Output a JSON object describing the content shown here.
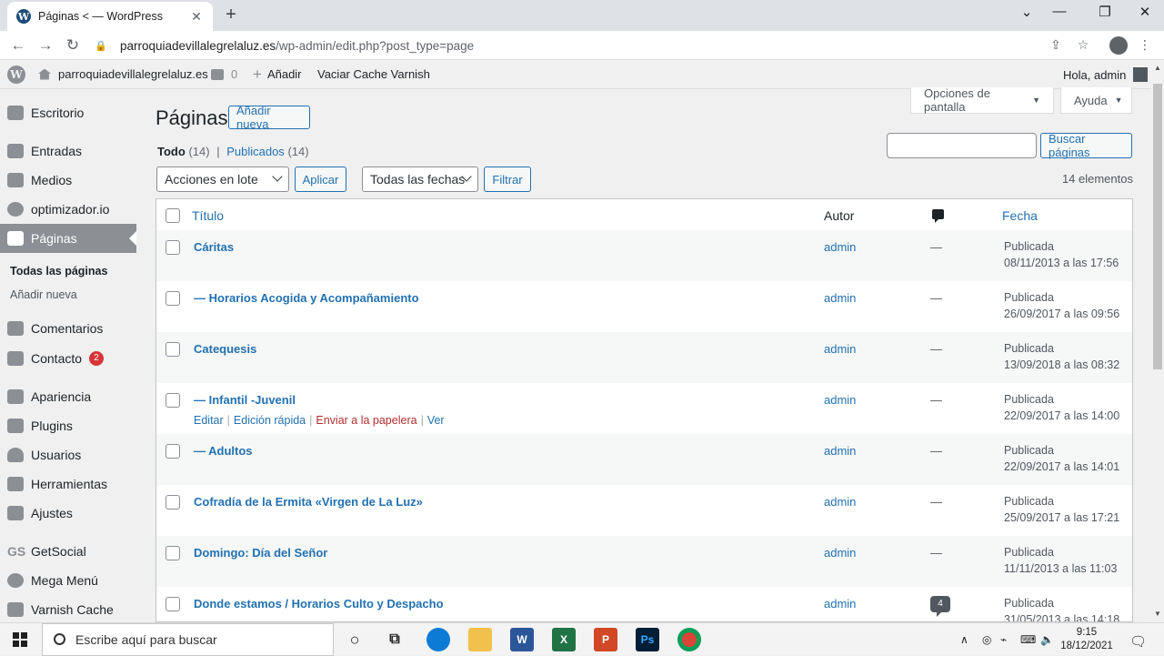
{
  "browser": {
    "tab_title": "Páginas < — WordPress",
    "tab_favicon": "W",
    "new_tab": "+",
    "url_domain": "parroquiadevillalegrelaluz.es",
    "url_path": "/wp-admin/edit.php?post_type=page"
  },
  "admin_bar": {
    "logo": "W",
    "site_name": "parroquiadevillalegrelaluz.es",
    "comments_count": "0",
    "add_new": "Añadir",
    "cache": "Vaciar Cache Varnish",
    "greeting": "Hola, admin"
  },
  "sidebar": {
    "dashboard": "Escritorio",
    "posts": "Entradas",
    "media": "Medios",
    "optimizer": "optimizador.io",
    "pages": "Páginas",
    "pages_all": "Todas las páginas",
    "pages_add": "Añadir nueva",
    "comments": "Comentarios",
    "contact": "Contacto",
    "contact_badge": "2",
    "appearance": "Apariencia",
    "plugins": "Plugins",
    "users": "Usuarios",
    "tools": "Herramientas",
    "settings": "Ajustes",
    "getsocial_icon": "GS",
    "getsocial": "GetSocial",
    "megamenu": "Mega Menú",
    "varnish": "Varnish Cache"
  },
  "main": {
    "screen_options": "Opciones de pantalla",
    "help": "Ayuda",
    "title": "Páginas",
    "add_new": "Añadir nueva",
    "filter_all": "Todo",
    "filter_all_count": "(14)",
    "filter_sep": "|",
    "filter_published": "Publicados",
    "filter_published_count": "(14)",
    "search_button": "Buscar páginas",
    "bulk_actions": "Acciones en lote",
    "apply": "Aplicar",
    "all_dates": "Todas las fechas",
    "filter": "Filtrar",
    "items_count": "14 elementos"
  },
  "table": {
    "col_title": "Título",
    "col_author": "Autor",
    "col_date": "Fecha",
    "row_actions": {
      "edit": "Editar",
      "quick_edit": "Edición rápida",
      "trash": "Enviar a la papelera",
      "view": "Ver",
      "sep": "|"
    },
    "rows": [
      {
        "title": "Cáritas",
        "author": "admin",
        "comments": "—",
        "status": "Publicada",
        "date": "08/11/2013 a las 17:56"
      },
      {
        "title": "— Horarios Acogida y Acompañamiento",
        "author": "admin",
        "comments": "—",
        "status": "Publicada",
        "date": "26/09/2017 a las 09:56"
      },
      {
        "title": "Catequesis",
        "author": "admin",
        "comments": "—",
        "status": "Publicada",
        "date": "13/09/2018 a las 08:32"
      },
      {
        "title": "— Infantil -Juvenil",
        "author": "admin",
        "comments": "—",
        "status": "Publicada",
        "date": "22/09/2017 a las 14:00"
      },
      {
        "title": "— Adultos",
        "author": "admin",
        "comments": "—",
        "status": "Publicada",
        "date": "22/09/2017 a las 14:01"
      },
      {
        "title": "Cofradía de la Ermita «Virgen de La Luz»",
        "author": "admin",
        "comments": "—",
        "status": "Publicada",
        "date": "25/09/2017 a las 17:21"
      },
      {
        "title": "Domingo: Día del Señor",
        "author": "admin",
        "comments": "—",
        "status": "Publicada",
        "date": "11/11/2013 a las 11:03"
      },
      {
        "title": "Donde estamos / Horarios Culto y Despacho",
        "author": "admin",
        "comments": "4",
        "status": "Publicada",
        "date": "31/05/2013 a las 14:18"
      }
    ]
  },
  "taskbar": {
    "search_placeholder": "Escribe aquí para buscar",
    "word": "W",
    "excel": "X",
    "powerpoint": "P",
    "photoshop": "Ps",
    "time": "9:15",
    "date": "18/12/2021"
  }
}
